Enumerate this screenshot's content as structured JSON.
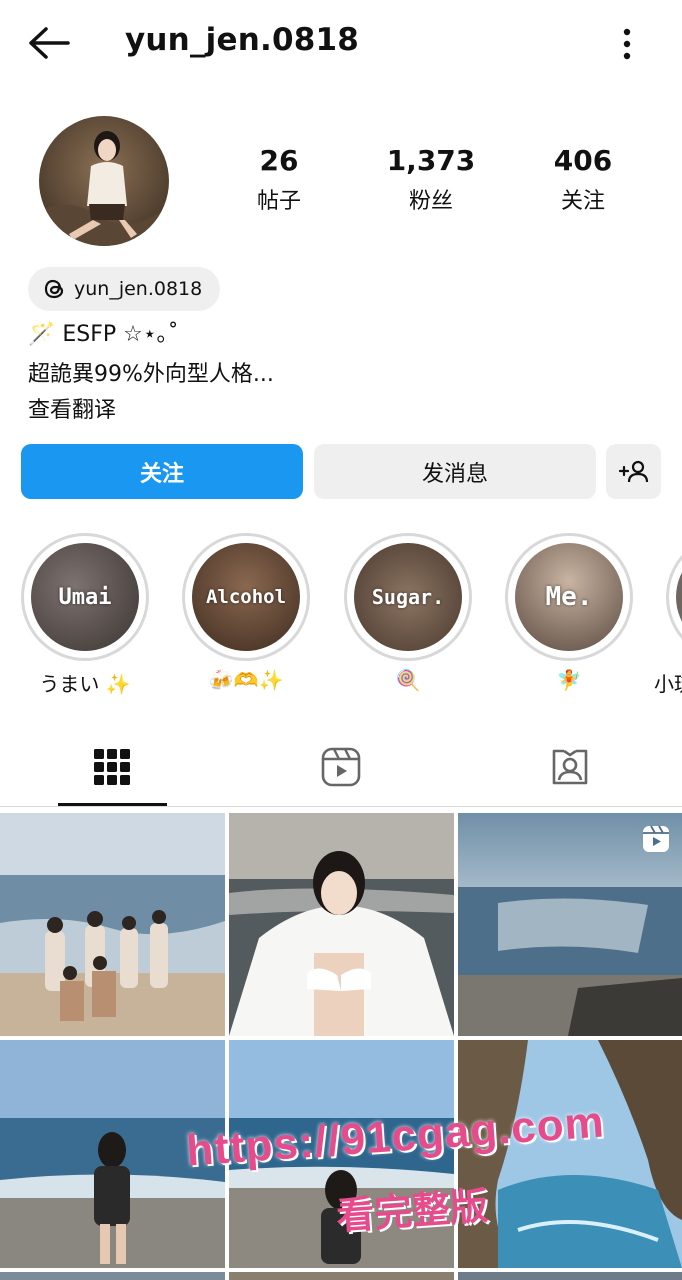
{
  "header": {
    "username": "yun_jen.0818"
  },
  "profile": {
    "stats": [
      {
        "value": "26",
        "label": "帖子"
      },
      {
        "value": "1,373",
        "label": "粉丝"
      },
      {
        "value": "406",
        "label": "关注"
      }
    ],
    "threads_handle": "yun_jen.0818",
    "bio_line1": "🪄 ESFP ☆⋆｡˚",
    "bio_line2": "超詭異99%外向型人格...",
    "translate_label": "查看翻译"
  },
  "actions": {
    "follow_label": "关注",
    "message_label": "发消息"
  },
  "highlights": [
    {
      "cover_text": "Umai",
      "label": "うまい ✨"
    },
    {
      "cover_text": "Alcohol",
      "label": "🍻🫶✨"
    },
    {
      "cover_text": "Sugar.",
      "label": "🍭"
    },
    {
      "cover_text": "Me.",
      "label": "🧚"
    },
    {
      "cover_text": "",
      "label": "小琉"
    }
  ],
  "tabs": [
    "grid-icon",
    "reels-icon",
    "tagged-icon"
  ],
  "watermark": {
    "url": "https://91cgag.com",
    "sub": "看完整版"
  },
  "colors": {
    "follow_button": "#1a97f0",
    "secondary_button": "#efefef",
    "watermark": "#e64b8c"
  }
}
